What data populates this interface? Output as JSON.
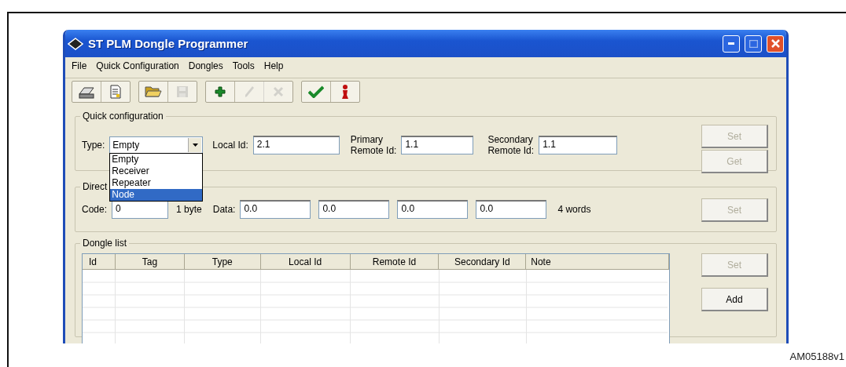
{
  "window": {
    "title": "ST PLM Dongle Programmer"
  },
  "menu": [
    "File",
    "Quick Configuration",
    "Dongles",
    "Tools",
    "Help"
  ],
  "toolbar": [
    {
      "kind": "scanner",
      "disabled": false
    },
    {
      "kind": "document",
      "disabled": false
    },
    {
      "kind": "folder",
      "disabled": false
    },
    {
      "kind": "save",
      "disabled": true
    },
    {
      "kind": "plus",
      "disabled": false
    },
    {
      "kind": "pencil",
      "disabled": true
    },
    {
      "kind": "cross",
      "disabled": true
    },
    {
      "kind": "check",
      "disabled": false
    },
    {
      "kind": "figure",
      "disabled": false
    }
  ],
  "quick_configuration": {
    "title": "Quick configuration",
    "type_label": "Type:",
    "type_value": "Empty",
    "dropdown_options": [
      {
        "label": "Empty",
        "selected": false
      },
      {
        "label": "Receiver",
        "selected": false
      },
      {
        "label": "Repeater",
        "selected": false
      },
      {
        "label": "Node",
        "selected": true
      }
    ],
    "local_id_label": "Local Id:",
    "local_id": "2.1",
    "primary_label": [
      "Primary",
      "Remote Id:"
    ],
    "primary_remote_id": "1.1",
    "secondary_label": [
      "Secondary",
      "Remote Id:"
    ],
    "secondary_remote_id": "1.1",
    "buttons": [
      {
        "label": "Set",
        "disabled": true
      },
      {
        "label": "Get",
        "disabled": true
      }
    ]
  },
  "direct": {
    "title": "Direct",
    "code_label": "Code:",
    "code": "0",
    "code_unit": "1 byte",
    "data_label": "Data:",
    "data": [
      "0.0",
      "0.0",
      "0.0",
      "0.0"
    ],
    "data_unit": "4 words",
    "buttons": [
      {
        "label": "Set",
        "disabled": true
      }
    ]
  },
  "dongle_list": {
    "title": "Dongle list",
    "columns": [
      "Id",
      "Tag",
      "Type",
      "Local Id",
      "Remote Id",
      "Secondary Id",
      "Note"
    ],
    "buttons": [
      {
        "label": "Set",
        "disabled": true
      },
      {
        "label": "Add",
        "disabled": false
      }
    ]
  },
  "figure_id": "AM05188v1"
}
